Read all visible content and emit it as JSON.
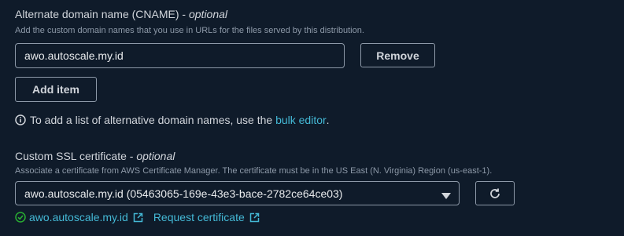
{
  "cname": {
    "label": "Alternate domain name (CNAME)",
    "label_suffix": "optional",
    "description": "Add the custom domain names that you use in URLs for the files served by this distribution.",
    "value": "awo.autoscale.my.id",
    "remove_label": "Remove",
    "add_item_label": "Add item",
    "info_text": "To add a list of alternative domain names, use the ",
    "info_link": "bulk editor",
    "info_end": "."
  },
  "ssl": {
    "label": "Custom SSL certificate",
    "label_suffix": "optional",
    "description": "Associate a certificate from AWS Certificate Manager. The certificate must be in the US East (N. Virginia) Region (us-east-1).",
    "selected": "awo.autoscale.my.id (05463065-169e-43e3-bace-2782ce64ce03)",
    "status_link": "awo.autoscale.my.id",
    "request_link": "Request certificate"
  },
  "colors": {
    "background": "#0f1b2a",
    "link": "#44b9d6",
    "success": "#29ad32",
    "border": "#8d99a8"
  },
  "icons": [
    "info-icon",
    "dropdown-caret-icon",
    "refresh-icon",
    "check-circle-icon",
    "external-link-icon"
  ]
}
